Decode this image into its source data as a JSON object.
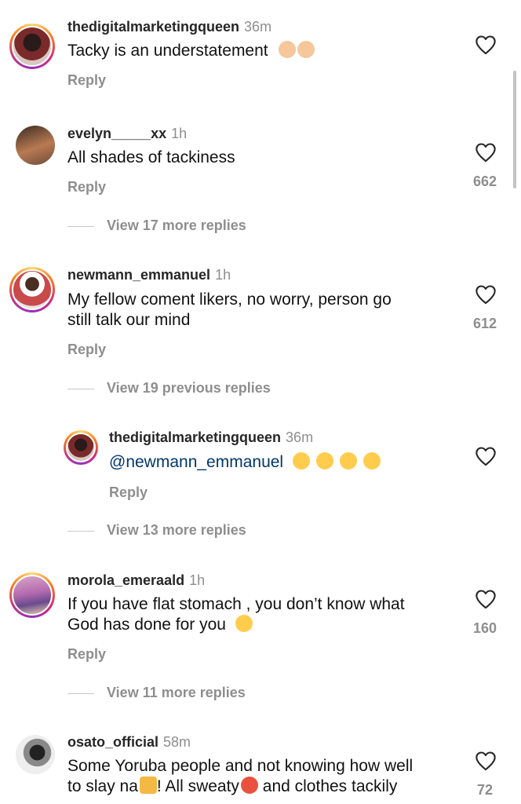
{
  "comments": [
    {
      "username": "thedigitalmarketingqueen",
      "time": "36m",
      "text": "Tacky is an understatement",
      "reply": "Reply",
      "likes": ""
    },
    {
      "username": "evelyn_____xx",
      "time": "1h",
      "text": "All shades of tackiness",
      "reply": "Reply",
      "likes": "662",
      "view_more": "View 17 more replies"
    },
    {
      "username": "newmann_emmanuel",
      "time": "1h",
      "text_line1": "My fellow coment likers, no worry, person go",
      "text_line2": "still talk our mind",
      "reply": "Reply",
      "likes": "612",
      "view_previous": "View 19 previous replies"
    },
    {
      "username": "thedigitalmarketingqueen",
      "time": "36m",
      "mention": "@newmann_emmanuel",
      "reply": "Reply",
      "view_more": "View 13 more replies"
    },
    {
      "username": "morola_emeraald",
      "time": "1h",
      "text_line1": "If you have flat stomach , you don’t know what",
      "text_line2": "God has done for you",
      "reply": "Reply",
      "likes": "160",
      "view_more": "View 11 more replies"
    },
    {
      "username": "osato_official",
      "time": "58m",
      "text_line1": "Some Yoruba people and not knowing how well",
      "text_line2a": "to slay na",
      "text_line2b": "! All sweaty",
      "text_line2c": " and clothes tackily",
      "likes": "72"
    }
  ],
  "icons": {
    "like": "heart-outline-icon",
    "emoji_facepalm": "woman-facepalming-emoji",
    "emoji_laugh": "tears-of-joy-emoji",
    "emoji_cry": "crying-face-emoji",
    "emoji_handshake": "handshake-emoji",
    "emoji_hot": "hot-face-emoji"
  },
  "colors": {
    "accent_link": "#00376b",
    "muted": "#8e8e8e"
  }
}
